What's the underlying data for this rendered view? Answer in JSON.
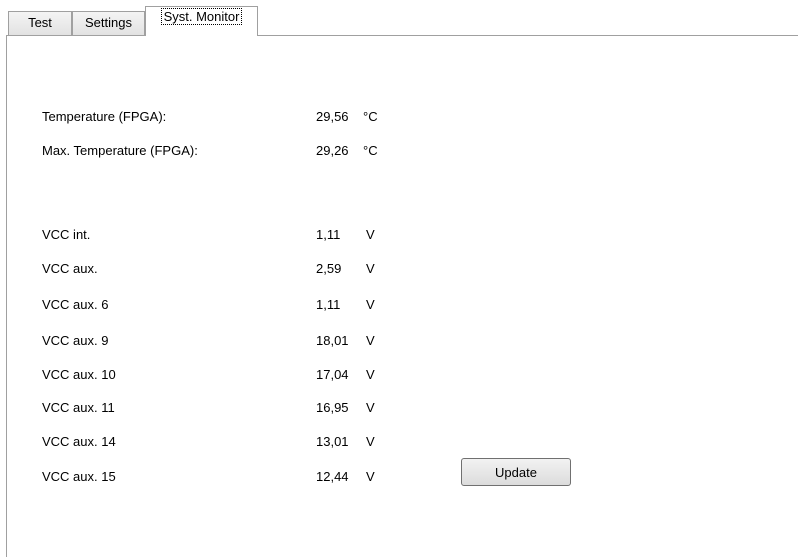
{
  "tabs": [
    {
      "label": "Test"
    },
    {
      "label": "Settings"
    },
    {
      "label": "Syst. Monitor"
    }
  ],
  "active_tab": "Syst. Monitor",
  "temperature": [
    {
      "label": "Temperature (FPGA):",
      "value": "29,56",
      "unit": "°C"
    },
    {
      "label": "Max. Temperature (FPGA):",
      "value": "29,26",
      "unit": "°C"
    }
  ],
  "voltages": [
    {
      "label": "VCC int.",
      "value": "1,11",
      "unit": "V"
    },
    {
      "label": "VCC aux.",
      "value": "2,59",
      "unit": "V"
    },
    {
      "label": "VCC aux. 6",
      "value": "1,11",
      "unit": "V"
    },
    {
      "label": "VCC aux. 9",
      "value": "18,01",
      "unit": "V"
    },
    {
      "label": "VCC aux. 10",
      "value": "17,04",
      "unit": "V"
    },
    {
      "label": "VCC aux. 11",
      "value": "16,95",
      "unit": "V"
    },
    {
      "label": "VCC aux. 14",
      "value": "13,01",
      "unit": "V"
    },
    {
      "label": "VCC aux. 15",
      "value": "12,44",
      "unit": "V"
    }
  ],
  "update_button": {
    "label": "Update"
  }
}
